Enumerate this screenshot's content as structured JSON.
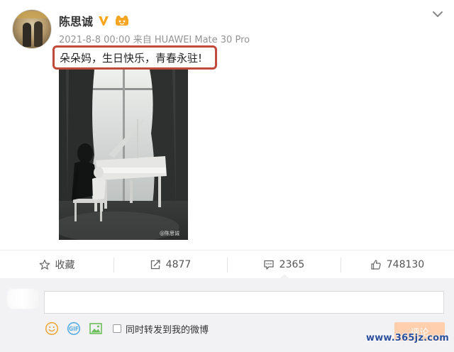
{
  "post": {
    "username": "陈思诚",
    "verified_badge": "V",
    "meta": "2021-8-8 00:00 来自 HUAWEI Mate 30 Pro",
    "text": "朵朵妈，生日快乐，青春永驻!",
    "image_watermark": "@陈思诚",
    "highlight_color": "#c24a3a"
  },
  "actions": [
    {
      "icon": "star-icon",
      "label": "收藏"
    },
    {
      "icon": "share-icon",
      "label": "4877"
    },
    {
      "icon": "comment-icon",
      "label": "2365"
    },
    {
      "icon": "like-icon",
      "label": "748130"
    }
  ],
  "comment_box": {
    "input_value": "",
    "repost_label": "同时转发到我的微博",
    "repost_checked": false,
    "submit_label": "评论",
    "tools": [
      "emoji-icon",
      "gif-icon",
      "image-icon"
    ]
  },
  "site_watermark": "www.365jz.com",
  "colors": {
    "accent_orange": "#ff8140",
    "submit_disabled": "#ffcfae",
    "comment_bg": "#f2f2f5",
    "watermark_blue": "#2c4f9c"
  }
}
